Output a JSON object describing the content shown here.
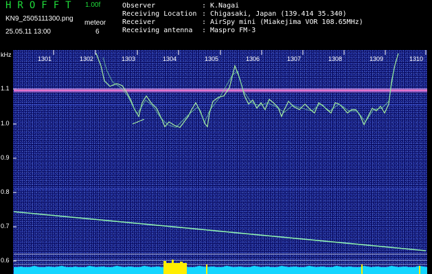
{
  "header": {
    "app_title": "HROFFT",
    "version": "1.00f",
    "filename": "KN9_2505111300.png",
    "datetime": "25.05.11 13:00",
    "meteor_label": "meteor",
    "meteor_count": "6",
    "info": [
      {
        "key": "Observer",
        "value": "K.Nagai"
      },
      {
        "key": "Receiving Location",
        "value": "Chigasaki, Japan (139.414 35.340)"
      },
      {
        "key": "Receiver",
        "value": "AirSpy mini (Miakejima VOR 108.65MHz)"
      },
      {
        "key": "Receiving antenna",
        "value": "Maspro FM-3"
      }
    ]
  },
  "axes": {
    "y_unit": "kHz",
    "y_ticks": [
      "1.1",
      "1.0",
      "0.9",
      "0.8",
      "0.7",
      "0.6"
    ],
    "x_ticks": [
      "1301",
      "1302",
      "1303",
      "1304",
      "1305",
      "1306",
      "1307",
      "1308",
      "1309",
      "1310"
    ]
  },
  "colors": {
    "title_green": "#1fdc3a",
    "background_blue": "#0b0f66",
    "trace_green": "#a8f0a0",
    "carrier_line": "#ff7ad0",
    "bottom_band": "#14d6ff",
    "meteor_yellow": "#ffee00"
  }
}
